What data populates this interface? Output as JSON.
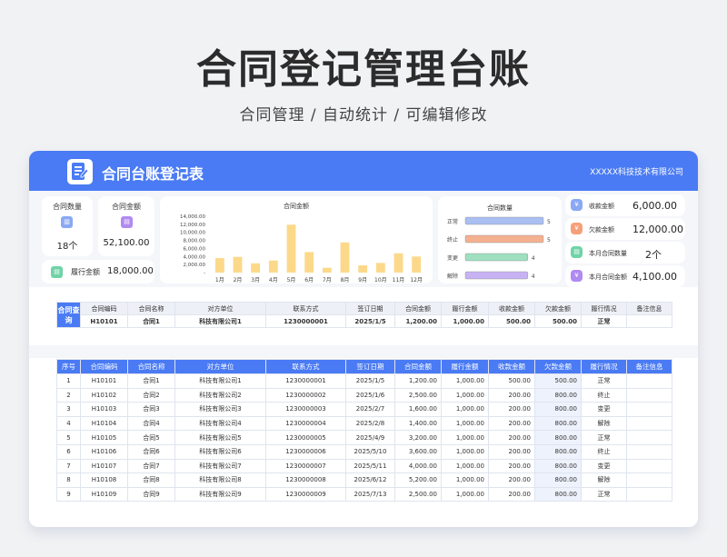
{
  "page": {
    "title": "合同登记管理台账",
    "subtitle": "合同管理 /  自动统计  /  可编辑修改"
  },
  "header": {
    "title": "合同台账登记表",
    "company": "XXXXX科技技术有限公司"
  },
  "kpi": {
    "contract_count": {
      "label": "合同数量",
      "value": "18个"
    },
    "contract_amount": {
      "label": "合同金额",
      "value": "52,100.00"
    },
    "performed_amount": {
      "label": "履行金额",
      "value": "18,000.00"
    }
  },
  "bar_chart": {
    "title": "合同金额",
    "y_ticks": [
      "14,000.00",
      "12,000.00",
      "10,000.00",
      "8,000.00",
      "6,000.00",
      "4,000.00",
      "2,000.00",
      "-"
    ]
  },
  "chart_data": [
    {
      "type": "bar",
      "title": "合同金额",
      "categories": [
        "1月",
        "2月",
        "3月",
        "4月",
        "5月",
        "6月",
        "7月",
        "8月",
        "9月",
        "10月",
        "11月",
        "12月"
      ],
      "values": [
        3600,
        3900,
        2300,
        3000,
        11900,
        5100,
        1200,
        7500,
        1800,
        2400,
        4800,
        4000
      ],
      "ylim": [
        0,
        14000
      ],
      "color": "#fcd98a",
      "grid": false
    },
    {
      "type": "bar",
      "orientation": "horizontal",
      "title": "合同数量",
      "categories": [
        "正常",
        "终止",
        "变更",
        "解除"
      ],
      "values": [
        5,
        5,
        4,
        4
      ],
      "colors": [
        "#aabff2",
        "#f4b190",
        "#9ee0c0",
        "#c7b3f4"
      ],
      "xlim": [
        0,
        5
      ]
    }
  ],
  "side_stats": [
    {
      "label": "收款金额",
      "value": "6,000.00",
      "icon": "yen-icon",
      "color": "#8aa8f4"
    },
    {
      "label": "欠款金额",
      "value": "12,000.00",
      "icon": "yen-icon",
      "color": "#f6a07a"
    },
    {
      "label": "本月合同数量",
      "value": "2个",
      "icon": "document-icon",
      "color": "#6fd3a6"
    },
    {
      "label": "本月合同金额",
      "value": "4,100.00",
      "icon": "yen-icon",
      "color": "#b08af0"
    }
  ],
  "query": {
    "label": "合同查询",
    "headers": [
      "合同编码",
      "合同名称",
      "对方单位",
      "联系方式",
      "签订日期",
      "合同金额",
      "履行金额",
      "收款金额",
      "欠款金额",
      "履行情况",
      "备注信息"
    ],
    "row": [
      "H10101",
      "合同1",
      "科技有限公司1",
      "1230000001",
      "2025/1/5",
      "1,200.00",
      "1,000.00",
      "500.00",
      "500.00",
      "正常",
      ""
    ]
  },
  "table": {
    "headers": [
      "序号",
      "合同编码",
      "合同名称",
      "对方单位",
      "联系方式",
      "签订日期",
      "合同金额",
      "履行金额",
      "收款金额",
      "欠款金额",
      "履行情况",
      "备注信息"
    ],
    "rows": [
      [
        "1",
        "H10101",
        "合同1",
        "科技有限公司1",
        "1230000001",
        "2025/1/5",
        "1,200.00",
        "1,000.00",
        "500.00",
        "500.00",
        "正常",
        ""
      ],
      [
        "2",
        "H10102",
        "合同2",
        "科技有限公司2",
        "1230000002",
        "2025/1/6",
        "2,500.00",
        "1,000.00",
        "200.00",
        "800.00",
        "终止",
        ""
      ],
      [
        "3",
        "H10103",
        "合同3",
        "科技有限公司3",
        "1230000003",
        "2025/2/7",
        "1,600.00",
        "1,000.00",
        "200.00",
        "800.00",
        "变更",
        ""
      ],
      [
        "4",
        "H10104",
        "合同4",
        "科技有限公司4",
        "1230000004",
        "2025/2/8",
        "1,400.00",
        "1,000.00",
        "200.00",
        "800.00",
        "解除",
        ""
      ],
      [
        "5",
        "H10105",
        "合同5",
        "科技有限公司5",
        "1230000005",
        "2025/4/9",
        "3,200.00",
        "1,000.00",
        "200.00",
        "800.00",
        "正常",
        ""
      ],
      [
        "6",
        "H10106",
        "合同6",
        "科技有限公司6",
        "1230000006",
        "2025/5/10",
        "3,600.00",
        "1,000.00",
        "200.00",
        "800.00",
        "终止",
        ""
      ],
      [
        "7",
        "H10107",
        "合同7",
        "科技有限公司7",
        "1230000007",
        "2025/5/11",
        "4,000.00",
        "1,000.00",
        "200.00",
        "800.00",
        "变更",
        ""
      ],
      [
        "8",
        "H10108",
        "合同8",
        "科技有限公司8",
        "1230000008",
        "2025/6/12",
        "5,200.00",
        "1,000.00",
        "200.00",
        "800.00",
        "解除",
        ""
      ],
      [
        "9",
        "H10109",
        "合同9",
        "科技有限公司9",
        "1230000009",
        "2025/7/13",
        "2,500.00",
        "1,000.00",
        "200.00",
        "800.00",
        "正常",
        ""
      ]
    ]
  }
}
